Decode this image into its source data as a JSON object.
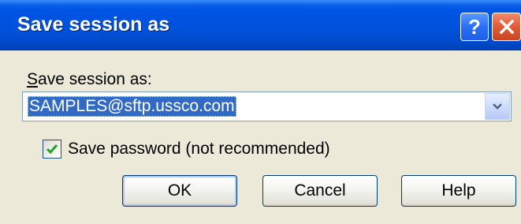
{
  "window": {
    "title": "Save session as",
    "titlebar_buttons": [
      {
        "icon": "help-icon",
        "label": "?"
      },
      {
        "icon": "close-icon",
        "label": "X"
      }
    ]
  },
  "form": {
    "session_label_accesskey": "S",
    "session_label_rest": "ave session as:",
    "session_value": "SAMPLES@sftp.ussco.com",
    "dropdown_icon": "chevron-down-icon",
    "save_password": {
      "checked": true,
      "label": "Save password (not recommended)"
    }
  },
  "buttons": {
    "ok": "OK",
    "cancel": "Cancel",
    "help": "Help"
  },
  "colors": {
    "titlebar": "#0054e3",
    "dialog_bg": "#ece9d8",
    "selection": "#316ac5",
    "close_button": "#e15b36"
  }
}
